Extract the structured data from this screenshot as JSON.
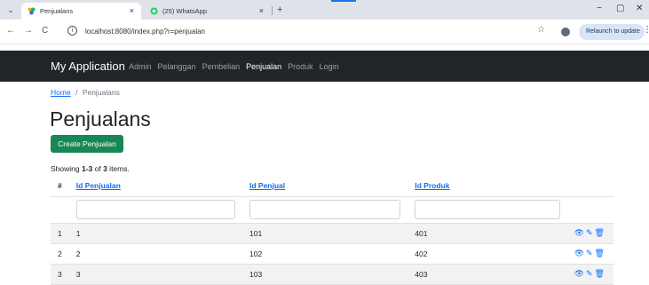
{
  "browser": {
    "tabs": [
      {
        "title": "Penjualans",
        "close": "×",
        "active": true
      },
      {
        "title": "(25) WhatsApp",
        "close": "×",
        "active": false
      }
    ],
    "new_tab": "+",
    "url": "localhost:8080/index.php?r=penjualan",
    "relaunch_label": "Relaunch to update",
    "window": {
      "minimize": "−",
      "maximize": "▢",
      "close": "✕"
    },
    "nav": {
      "back": "←",
      "forward": "→",
      "reload": "C",
      "star": "☆",
      "menu": "⋮"
    },
    "menu_toggle": "⌄",
    "info_glyph": "i"
  },
  "navbar": {
    "brand": "My Application",
    "links": [
      {
        "label": "Admin",
        "active": false
      },
      {
        "label": "Pelanggan",
        "active": false
      },
      {
        "label": "Pembelian",
        "active": false
      },
      {
        "label": "Penjualan",
        "active": true
      },
      {
        "label": "Produk",
        "active": false
      },
      {
        "label": "Login",
        "active": false
      }
    ]
  },
  "breadcrumb": {
    "home": "Home",
    "separator": "/",
    "current": "Penjualans"
  },
  "page": {
    "title": "Penjualans",
    "create_button": "Create Penjualan",
    "summary": {
      "prefix": "Showing ",
      "range": "1-3",
      "middle": " of ",
      "total": "3",
      "suffix": " items."
    }
  },
  "table": {
    "columns": [
      "#",
      "Id Penjualan",
      "Id Penjual",
      "Id Produk",
      ""
    ],
    "rows": [
      [
        "1",
        "1",
        "101",
        "401"
      ],
      [
        "2",
        "2",
        "102",
        "402"
      ],
      [
        "3",
        "3",
        "103",
        "403"
      ]
    ],
    "action_icons": [
      "eye-icon",
      "pencil-icon",
      "trash-icon"
    ],
    "action_glyphs": [
      "👁",
      "✎",
      "🗑"
    ]
  },
  "colors": {
    "navbar": "#212529",
    "link": "#0d6efd",
    "create_button": "#198754"
  }
}
